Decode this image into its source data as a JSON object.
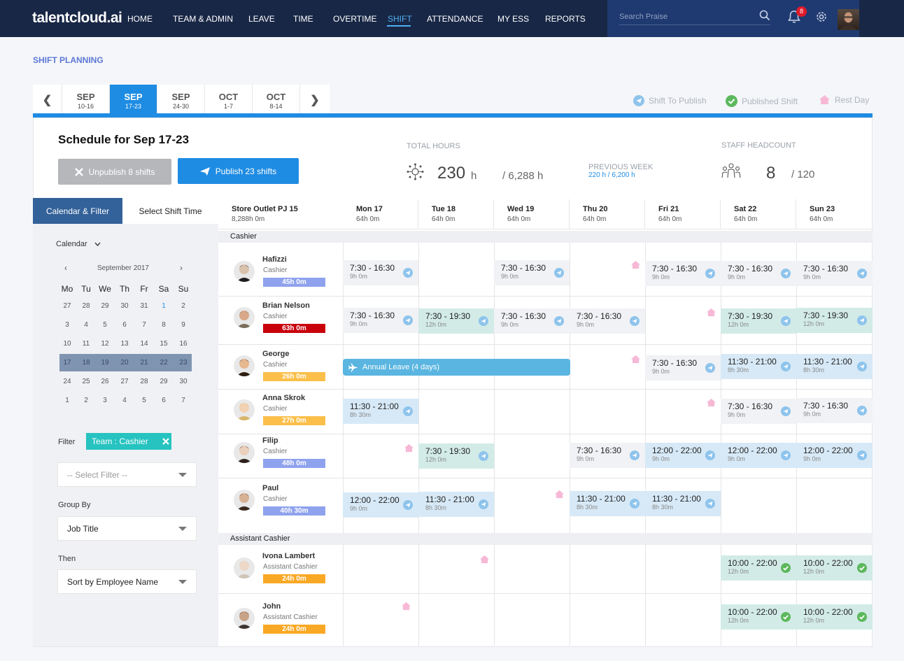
{
  "app": {
    "logo": "talentcloud.ai"
  },
  "nav": {
    "items": [
      "HOME",
      "TEAM & ADMIN",
      "LEAVE",
      "TIME",
      "OVERTIME",
      "SHIFT",
      "ATTENDANCE",
      "MY ESS",
      "REPORTS"
    ],
    "active": "SHIFT"
  },
  "search": {
    "placeholder": "Search Praise"
  },
  "notifications": {
    "count": "8"
  },
  "page": {
    "title": "SHIFT PLANNING"
  },
  "weeks": [
    {
      "month": "SEP",
      "range": "10-16"
    },
    {
      "month": "SEP",
      "range": "17-23"
    },
    {
      "month": "SEP",
      "range": "24-30"
    },
    {
      "month": "OCT",
      "range": "1-7"
    },
    {
      "month": "OCT",
      "range": "8-14"
    }
  ],
  "legend": {
    "to_publish": "Shift To Publish",
    "published": "Published Shift",
    "rest": "Rest Day"
  },
  "schedule": {
    "title": "Schedule for Sep 17-23",
    "unpublish_label": "Unpublish 8 shifts",
    "publish_label": "Publish 23 shifts"
  },
  "stats": {
    "total_hours_label": "TOTAL HOURS",
    "total_hours": "230",
    "total_hours_unit": "h",
    "total_hours_cap": "/ 6,288 h",
    "prev_week_label": "PREVIOUS WEEK",
    "prev_week_value": "220 h / 6,200 h",
    "headcount_label": "STAFF HEADCOUNT",
    "headcount": "8",
    "headcount_cap": "/ 120"
  },
  "sidebar": {
    "tab_calendar": "Calendar & Filter",
    "tab_shift_time": "Select Shift Time",
    "calendar_label": "Calendar",
    "month": "September 2017",
    "weekdays": [
      "Mo",
      "Tu",
      "We",
      "Th",
      "Fr",
      "Sa",
      "Su"
    ],
    "weeks": [
      [
        "27",
        "28",
        "29",
        "30",
        "31",
        "1",
        "2"
      ],
      [
        "3",
        "4",
        "5",
        "6",
        "7",
        "8",
        "9"
      ],
      [
        "10",
        "11",
        "12",
        "13",
        "14",
        "15",
        "16"
      ],
      [
        "17",
        "18",
        "19",
        "20",
        "21",
        "22",
        "23"
      ],
      [
        "24",
        "25",
        "26",
        "27",
        "28",
        "29",
        "30"
      ],
      [
        "1",
        "2",
        "3",
        "4",
        "5",
        "6",
        "7"
      ]
    ],
    "filter_label": "Filter",
    "filter_chip": "Team : Cashier",
    "select_filter": "-- Select Filter --",
    "group_by_label": "Group By",
    "group_by_value": "Job Title",
    "then_label": "Then",
    "then_value": "Sort by Employee Name"
  },
  "grid": {
    "store": "Store Outlet PJ 15",
    "store_hours": "8,288h 0m",
    "days": [
      {
        "day": "Mon 17",
        "hours": "64h 0m"
      },
      {
        "day": "Tue 18",
        "hours": "64h 0m"
      },
      {
        "day": "Wed 19",
        "hours": "64h 0m"
      },
      {
        "day": "Thu 20",
        "hours": "64h 0m"
      },
      {
        "day": "Fri 21",
        "hours": "64h 0m"
      },
      {
        "day": "Sat 22",
        "hours": "64h 0m"
      },
      {
        "day": "Sun 23",
        "hours": "64h 0m"
      }
    ],
    "groups": [
      "Cashier",
      "Assistant Cashier"
    ],
    "leave_label": "Annual Leave (4 days)"
  },
  "employees": [
    {
      "name": "Hafizzi",
      "role": "Cashier",
      "hours": "45h 0m",
      "color": "#8fa2ee"
    },
    {
      "name": "Brian Nelson",
      "role": "Cashier",
      "hours": "63h 0m",
      "color": "#c8000c"
    },
    {
      "name": "George",
      "role": "Cashier",
      "hours": "26h 0m",
      "color": "#fbbf4a"
    },
    {
      "name": "Anna Skrok",
      "role": "Cashier",
      "hours": "27h 0m",
      "color": "#fbbf4a"
    },
    {
      "name": "Filip",
      "role": "Cashier",
      "hours": "48h 0m",
      "color": "#8fa2ee"
    },
    {
      "name": "Paul",
      "role": "Cashier",
      "hours": "40h 30m",
      "color": "#8fa2ee"
    },
    {
      "name": "Ivona Lambert",
      "role": "Assistant Cashier",
      "hours": "24h 0m",
      "color": "#f9a825"
    },
    {
      "name": "John",
      "role": "Assistant Cashier",
      "hours": "24h 0m",
      "color": "#f9a825"
    }
  ],
  "shift_texts": {
    "t1": "7:30 - 16:30",
    "d1": "9h 0m",
    "t2": "7:30 - 19:30",
    "d2": "12h 0m",
    "t3": "11:30 - 21:00",
    "d3": "8h 30m",
    "t4": "12:00 - 22:00",
    "d4": "9h 0m",
    "t5": "10:00 - 22:00",
    "d5": "12h 0m"
  }
}
